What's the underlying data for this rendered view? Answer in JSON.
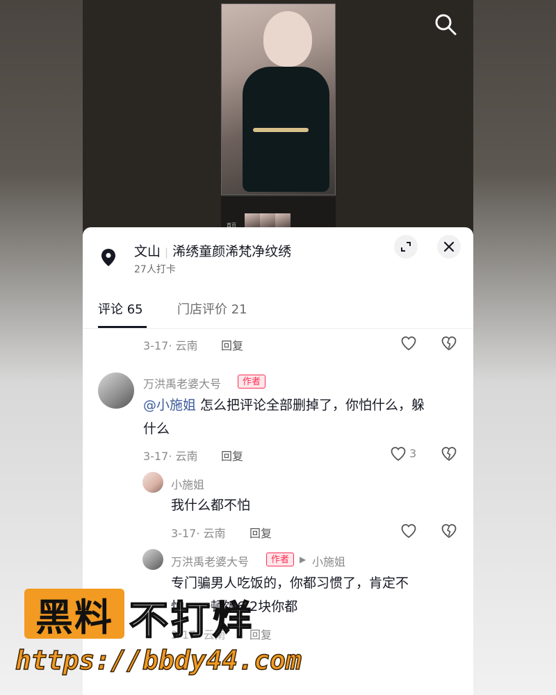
{
  "video": {
    "thumbnail_label": "首页"
  },
  "poi": {
    "location": "文山",
    "separator": "|",
    "name": "浠绣童颜浠梵净纹绣",
    "checkins": "27人打卡"
  },
  "tabs": [
    {
      "label": "评论 65",
      "active": true
    },
    {
      "label": "门店评价 21",
      "active": false
    }
  ],
  "comments": [
    {
      "meta": "3-17· 云南",
      "reply_label": "回复"
    },
    {
      "username": "万洪禹老婆大号",
      "badge": "作者",
      "mention": "@小施姐",
      "text_line1": " 怎么把评论全部删掉了，你怕什么，躲",
      "text_line2": "什么",
      "meta": "3-17· 云南",
      "reply_label": "回复",
      "likes": "3"
    },
    {
      "username": "小施姐",
      "text": "我什么都不怕",
      "meta": "3-17· 云南",
      "reply_label": "回复"
    },
    {
      "username": "万洪禹老婆大号",
      "badge": "作者",
      "reply_arrow": "▶",
      "reply_to": "小施姐",
      "text_line1": "专门骗男人吃饭的，你都习惯了，肯定不",
      "text_line2_visible": "怕，一顿饭6.2块你都",
      "meta": "3-17· 云南",
      "reply_label": "回复"
    }
  ],
  "watermark": {
    "box_text": "黑料",
    "text": "不打烊",
    "url": "https://bbdy44.com"
  },
  "colors": {
    "accent_red": "#fe2c55",
    "mention_blue": "#3c5a9a",
    "watermark_orange": "#f29a21"
  }
}
